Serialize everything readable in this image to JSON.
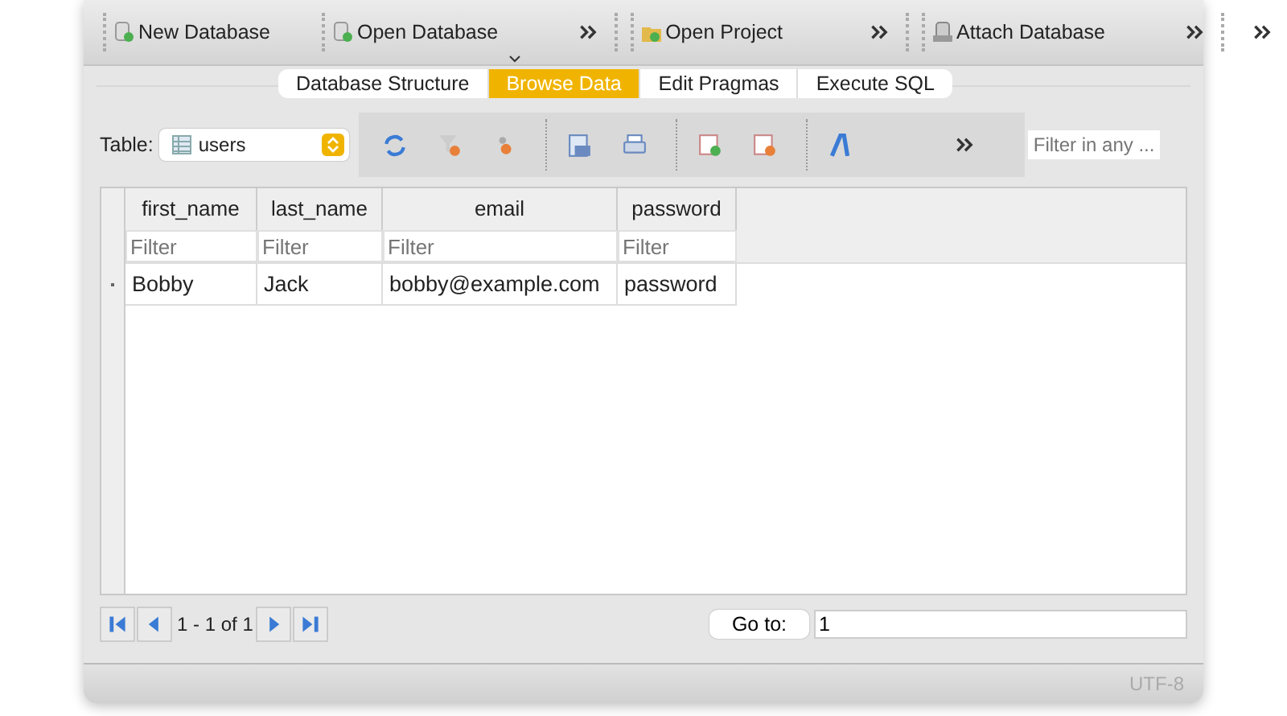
{
  "toolbar": [
    {
      "label": "New Database",
      "kind": "new"
    },
    {
      "label": "Open Database",
      "kind": "open"
    },
    {
      "label": "Open Project",
      "kind": "project"
    },
    {
      "label": "Attach Database",
      "kind": "attach"
    }
  ],
  "tabs": [
    {
      "label": "Database Structure",
      "selected": false
    },
    {
      "label": "Browse Data",
      "selected": true
    },
    {
      "label": "Edit Pragmas",
      "selected": false
    },
    {
      "label": "Execute SQL",
      "selected": false
    }
  ],
  "table_selector": {
    "label": "Table:",
    "value": "users"
  },
  "global_filter": {
    "placeholder": "Filter in any ..."
  },
  "grid": {
    "columns": [
      {
        "name": "first_name",
        "filter_placeholder": "Filter"
      },
      {
        "name": "last_name",
        "filter_placeholder": "Filter"
      },
      {
        "name": "email",
        "filter_placeholder": "Filter"
      },
      {
        "name": "password",
        "filter_placeholder": "Filter"
      }
    ],
    "rows": [
      [
        "Bobby",
        "Jack",
        "bobby@example.com",
        "password"
      ]
    ]
  },
  "pager": {
    "range": "1 - 1 of 1",
    "goto_label": "Go to:",
    "goto_value": "1"
  },
  "status_bar": {
    "encoding": "UTF-8"
  }
}
